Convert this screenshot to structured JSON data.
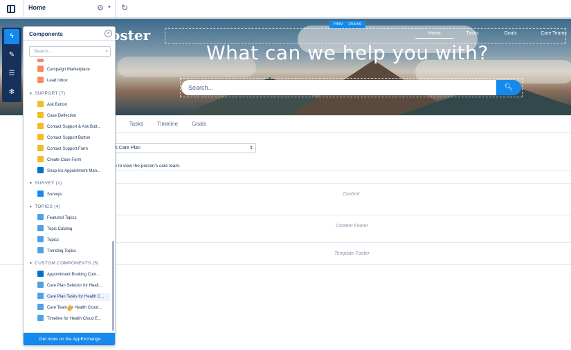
{
  "topbar": {
    "page": "Home",
    "settings_icon": "gear-icon",
    "dropdown_icon": "chevron-down-icon",
    "refresh_icon": "refresh-icon"
  },
  "hero": {
    "logo_text": "oster",
    "tag_label": "Hero",
    "tag_shared": "Shared",
    "nav": [
      "Home",
      "Tasks",
      "Goals",
      "Care Teams"
    ],
    "headline": "What can we help you with?",
    "search_placeholder": "Search..."
  },
  "page": {
    "tabs": [
      "m",
      "Tasks",
      "Timeline",
      "Goals"
    ],
    "care_select": "'s Care Plan",
    "care_hint": "me to view the person's care team.",
    "regions": [
      "Content",
      "Content Footer",
      "Template Footer"
    ]
  },
  "rail": {
    "icons": [
      "lightning-icon",
      "pencil-icon",
      "list-icon",
      "gear-icon"
    ]
  },
  "panel": {
    "title": "Components",
    "search_placeholder": "Search...",
    "footer": "Get more on the AppExchange",
    "top_items": [
      {
        "label": "Campaign Marketplace",
        "color": "#f88962"
      },
      {
        "label": "Lead Inbox",
        "color": "#f88962"
      }
    ],
    "groups": [
      {
        "name": "SUPPORT (7)",
        "items": [
          {
            "label": "Ask Button",
            "color": "#f4bc25"
          },
          {
            "label": "Case Deflection",
            "color": "#f4bc25"
          },
          {
            "label": "Contact Support & Ask Butt...",
            "color": "#f4bc25"
          },
          {
            "label": "Contact Support Button",
            "color": "#f4bc25"
          },
          {
            "label": "Contact Support Form",
            "color": "#f4bc25"
          },
          {
            "label": "Create Case Form",
            "color": "#f4bc25"
          },
          {
            "label": "Snap-ins Appointment Man...",
            "color": "#0070d2"
          }
        ]
      },
      {
        "name": "SURVEY (1)",
        "items": [
          {
            "label": "Surveys",
            "color": "#1589ee"
          }
        ]
      },
      {
        "name": "TOPICS (4)",
        "items": [
          {
            "label": "Featured Topics",
            "color": "#54a0e5"
          },
          {
            "label": "Topic Catalog",
            "color": "#54a0e5"
          },
          {
            "label": "Topics",
            "color": "#54a0e5"
          },
          {
            "label": "Trending Topics",
            "color": "#54a0e5"
          }
        ]
      },
      {
        "name": "CUSTOM COMPONENTS (5)",
        "items": [
          {
            "label": "Appointment Booking Com...",
            "color": "#0070d2"
          },
          {
            "label": "Care Plan Selector for Healt...",
            "color": "#54a0e5"
          },
          {
            "label": "Care Plan Tasks for Health C...",
            "color": "#54a0e5"
          },
          {
            "label": "Care Team for Health Cloud...",
            "color": "#54a0e5"
          },
          {
            "label": "Timeline for Health Cloud E...",
            "color": "#54a0e5"
          }
        ]
      }
    ]
  }
}
